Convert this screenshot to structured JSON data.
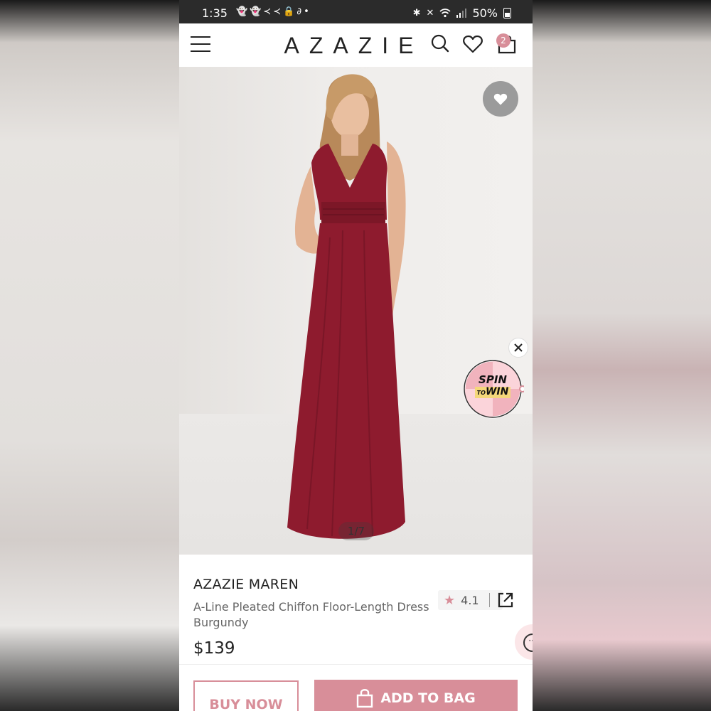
{
  "status_bar": {
    "time": "1:35",
    "battery": "50%",
    "left_icons": [
      "snapchat-icon",
      "snapchat-icon",
      "messenger-icon",
      "messenger-icon",
      "lock-icon",
      "link-icon",
      "dot-icon"
    ],
    "right_icons": [
      "bluetooth-icon",
      "mute-icon",
      "wifi-icon",
      "signal-icon",
      "battery-icon"
    ]
  },
  "header": {
    "brand": "AZAZIE",
    "cart_count": "2",
    "icons": [
      "menu-icon",
      "search-icon",
      "heart-icon",
      "bag-icon"
    ]
  },
  "gallery": {
    "counter": "1/7",
    "spin_top": "SPIN",
    "spin_to": "TO",
    "spin_win": "WIN"
  },
  "product": {
    "brand": "AZAZIE MAREN",
    "name": "A-Line Pleated Chiffon Floor-Length Dress Burgundy",
    "price": "$139",
    "rating": "4.1"
  },
  "actions": {
    "buy_now": "BUY NOW",
    "add_to_bag": "ADD TO BAG"
  },
  "colors": {
    "accent": "#d88e99",
    "dress": "#8e1b2e",
    "status_bar": "#2b2b2b"
  }
}
